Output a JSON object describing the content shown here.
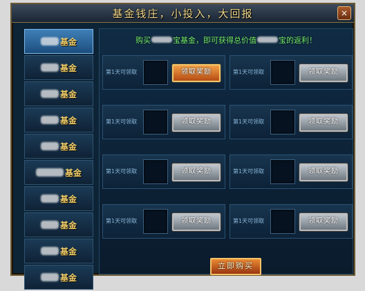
{
  "window": {
    "title": "基金钱庄，小投入，大回报",
    "close_label": "×"
  },
  "sidebar": {
    "items": [
      {
        "label": "基金"
      },
      {
        "label": "基金"
      },
      {
        "label": "基金"
      },
      {
        "label": "基金"
      },
      {
        "label": "基金"
      },
      {
        "label": "基金"
      },
      {
        "label": "基金"
      },
      {
        "label": "基金"
      },
      {
        "label": "基金"
      },
      {
        "label": "基金"
      }
    ]
  },
  "main": {
    "banner": {
      "part1": "购买",
      "part2": "宝基金，即可获得总价值",
      "part3": "宝的返利！"
    },
    "rewards": [
      {
        "label": "第1天可领取",
        "button": "领取奖励",
        "active": true
      },
      {
        "label": "第1天可领取",
        "button": "领取奖励",
        "active": false
      },
      {
        "label": "第1天可领取",
        "button": "领取奖励",
        "active": false
      },
      {
        "label": "第1天可领取",
        "button": "领取奖励",
        "active": false
      },
      {
        "label": "第1天可领取",
        "button": "领取奖励",
        "active": false
      },
      {
        "label": "第1天可领取",
        "button": "领取奖励",
        "active": false
      },
      {
        "label": "第1天可领取",
        "button": "领取奖励",
        "active": false
      },
      {
        "label": "第1天可领取",
        "button": "领取奖励",
        "active": false
      }
    ],
    "buy_button": "立即购买"
  }
}
